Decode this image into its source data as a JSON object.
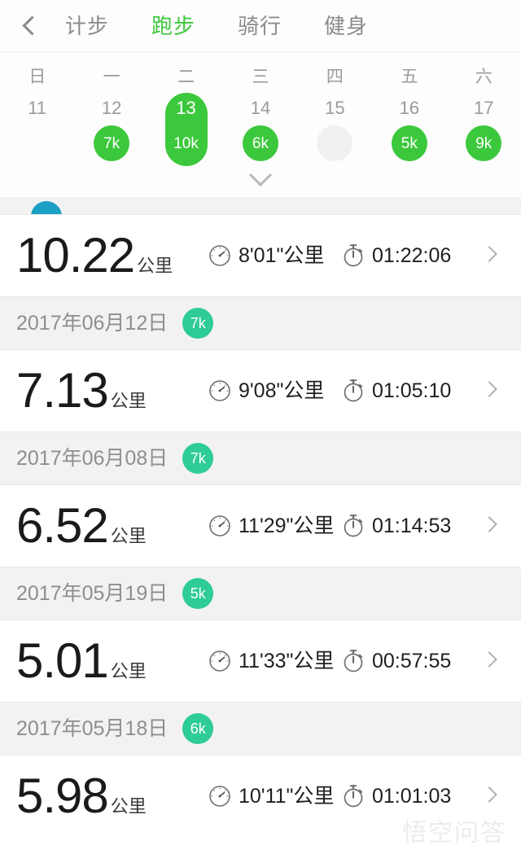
{
  "navbar": {
    "back_icon": "chevron-left-icon",
    "tabs": [
      {
        "label": "计步",
        "active": false
      },
      {
        "label": "跑步",
        "active": true
      },
      {
        "label": "骑行",
        "active": false
      },
      {
        "label": "健身",
        "active": false
      }
    ]
  },
  "calendar": {
    "weekdays": [
      "日",
      "一",
      "二",
      "三",
      "四",
      "五",
      "六"
    ],
    "days": [
      {
        "date": "11",
        "badge": "",
        "state": "none",
        "selected": false
      },
      {
        "date": "12",
        "badge": "7k",
        "state": "active",
        "selected": false
      },
      {
        "date": "13",
        "badge": "10k",
        "state": "active",
        "selected": true
      },
      {
        "date": "14",
        "badge": "6k",
        "state": "active",
        "selected": false
      },
      {
        "date": "15",
        "badge": "",
        "state": "empty",
        "selected": false
      },
      {
        "date": "16",
        "badge": "5k",
        "state": "active",
        "selected": false
      },
      {
        "date": "17",
        "badge": "9k",
        "state": "active",
        "selected": false
      }
    ],
    "expand_icon": "chevron-down-icon",
    "accent_green": "#3cc83c",
    "empty_gray": "#f0f0f0"
  },
  "list": {
    "pace_icon": "speedometer-icon",
    "time_icon": "stopwatch-icon",
    "row_arrow_icon": "chevron-right-icon",
    "header_badge_color": "#2ecc96",
    "groups": [
      {
        "header": {
          "date": "",
          "badge": "",
          "badge_color": "teal",
          "clipped": true
        },
        "records": [
          {
            "distance": "10.22",
            "unit": "公里",
            "pace": "8'01\"公里",
            "duration": "01:22:06"
          }
        ]
      },
      {
        "header": {
          "date": "2017年06月12日",
          "badge": "7k",
          "badge_color": "green",
          "clipped": false
        },
        "records": [
          {
            "distance": "7.13",
            "unit": "公里",
            "pace": "9'08\"公里",
            "duration": "01:05:10"
          }
        ]
      },
      {
        "header": {
          "date": "2017年06月08日",
          "badge": "7k",
          "badge_color": "green",
          "clipped": false
        },
        "records": [
          {
            "distance": "6.52",
            "unit": "公里",
            "pace": "11'29\"公里",
            "duration": "01:14:53"
          }
        ]
      },
      {
        "header": {
          "date": "2017年05月19日",
          "badge": "5k",
          "badge_color": "green",
          "clipped": false
        },
        "records": [
          {
            "distance": "5.01",
            "unit": "公里",
            "pace": "11'33\"公里",
            "duration": "00:57:55"
          }
        ]
      },
      {
        "header": {
          "date": "2017年05月18日",
          "badge": "6k",
          "badge_color": "green",
          "clipped": false
        },
        "records": [
          {
            "distance": "5.98",
            "unit": "公里",
            "pace": "10'11\"公里",
            "duration": "01:01:03"
          }
        ]
      }
    ]
  },
  "watermark": {
    "text": "悟空问答"
  }
}
